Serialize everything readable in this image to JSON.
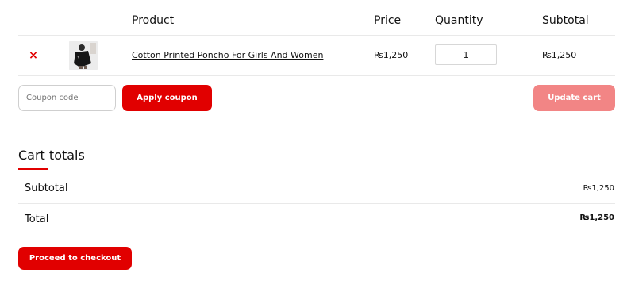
{
  "colors": {
    "accent": "#e10000",
    "accent_muted": "#f28585"
  },
  "table": {
    "headers": [
      "Product",
      "Price",
      "Quantity",
      "Subtotal"
    ],
    "rows": [
      {
        "remove_symbol": "×",
        "image_icon": "poncho-thumbnail",
        "product": "Cotton Printed Poncho For Girls And Women",
        "price": "₨1,250",
        "quantity": "1",
        "subtotal": "₨1,250"
      }
    ]
  },
  "coupon": {
    "placeholder": "Coupon code",
    "apply_label": "Apply coupon"
  },
  "update_label": "Update cart",
  "totals": {
    "title": "Cart totals",
    "subtotal_label": "Subtotal",
    "subtotal_value": "₨1,250",
    "total_label": "Total",
    "total_value": "₨1,250"
  },
  "checkout_label": "Proceed to checkout"
}
